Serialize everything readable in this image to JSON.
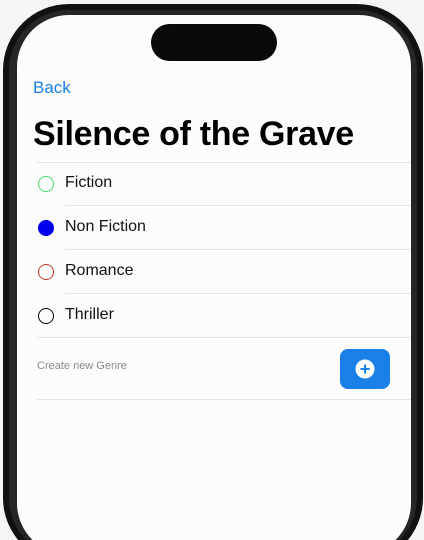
{
  "nav": {
    "back_label": "Back"
  },
  "book": {
    "title": "Silence of the Grave"
  },
  "genres": [
    {
      "label": "Fiction",
      "color": "#4cd964",
      "selected": false
    },
    {
      "label": "Non Fiction",
      "color": "#0000ee",
      "selected": true
    },
    {
      "label": "Romance",
      "color": "#c0392b",
      "selected": false
    },
    {
      "label": "Thriller",
      "color": "#000000",
      "selected": false
    }
  ],
  "create_genre": {
    "placeholder": "Create new Genre",
    "value": "",
    "add_icon": "plus-circle-icon"
  },
  "colors": {
    "accent": "#1a7fe6",
    "background": "#fcfcfc"
  }
}
